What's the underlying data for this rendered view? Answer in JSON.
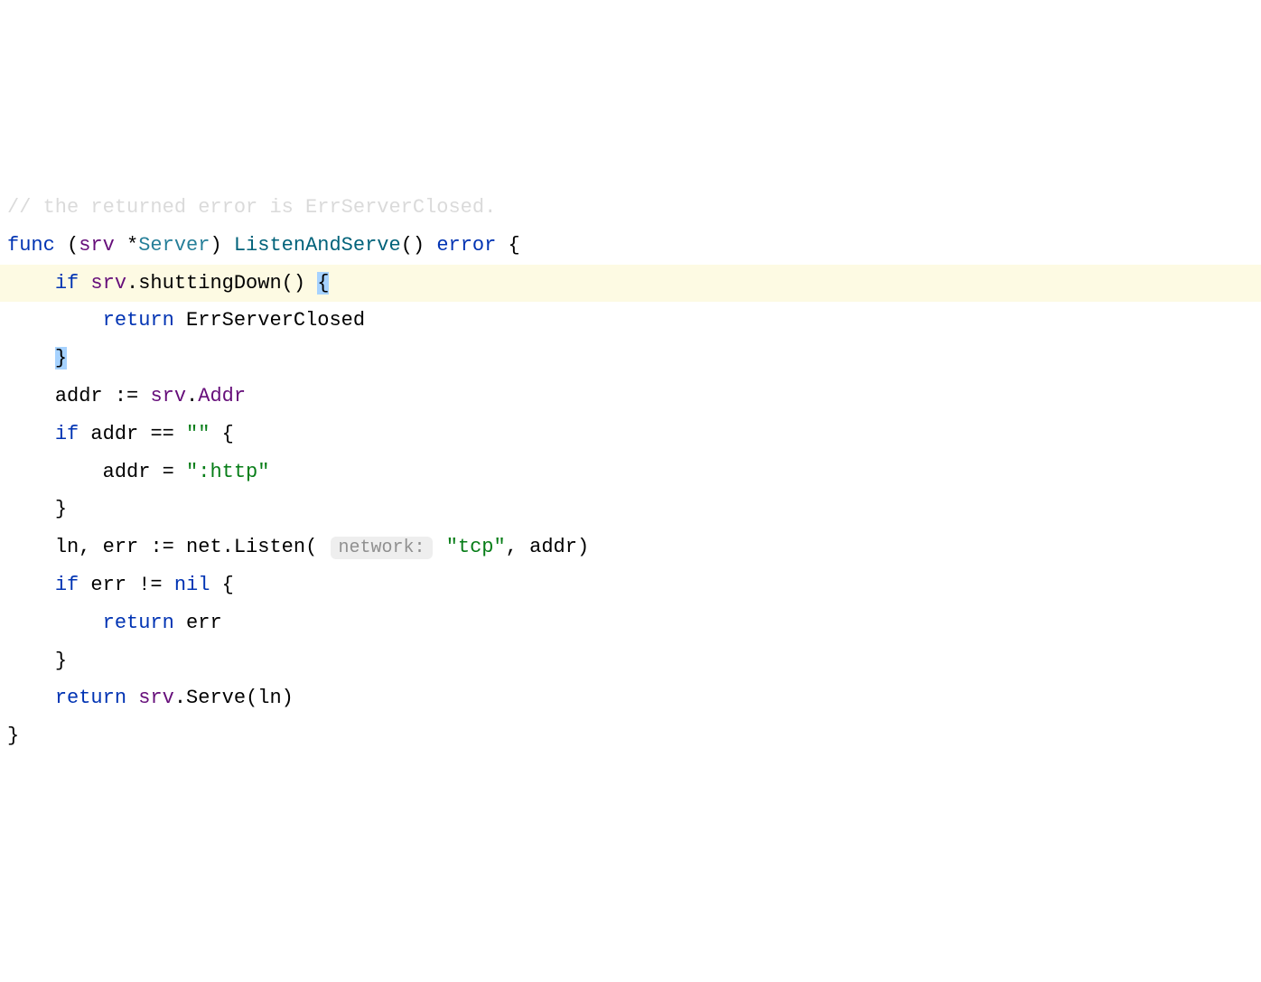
{
  "code": {
    "line0_comment": "// the returned error is ErrServerClosed.",
    "line1": {
      "kw_func": "func",
      "receiver_open": "(",
      "receiver_var": "srv",
      "star": "*",
      "receiver_type": "Server",
      "receiver_close": ")",
      "method_name": "ListenAndServe",
      "params": "()",
      "return_type": "error",
      "brace": "{"
    },
    "line2": {
      "kw_if": "if",
      "receiver": "srv",
      "dot": ".",
      "method": "shuttingDown",
      "call": "()",
      "brace_open": "{"
    },
    "line3": {
      "kw_return": "return",
      "value": "ErrServerClosed"
    },
    "line4": {
      "brace_close": "}"
    },
    "line5": {
      "var": "addr",
      "assign": ":=",
      "receiver": "srv",
      "dot": ".",
      "field": "Addr"
    },
    "line6": {
      "kw_if": "if",
      "var": "addr",
      "eq": "==",
      "empty": "\"\"",
      "brace": "{"
    },
    "line7": {
      "var": "addr",
      "assign": "=",
      "value": "\":http\""
    },
    "line8": {
      "brace": "}"
    },
    "line9": {
      "vars": "ln, err",
      "assign": ":=",
      "pkg": "net",
      "dot": ".",
      "func": "Listen",
      "open": "(",
      "hint_label": "network:",
      "arg1": "\"tcp\"",
      "comma": ",",
      "arg2": "addr",
      "close": ")"
    },
    "line10": {
      "kw_if": "if",
      "var": "err",
      "neq": "!=",
      "nil": "nil",
      "brace": "{"
    },
    "line11": {
      "kw_return": "return",
      "value": "err"
    },
    "line12": {
      "brace": "}"
    },
    "line13": {
      "kw_return": "return",
      "receiver": "srv",
      "dot": ".",
      "method": "Serve",
      "open": "(",
      "arg": "ln",
      "close": ")"
    },
    "line14": {
      "brace": "}"
    }
  }
}
